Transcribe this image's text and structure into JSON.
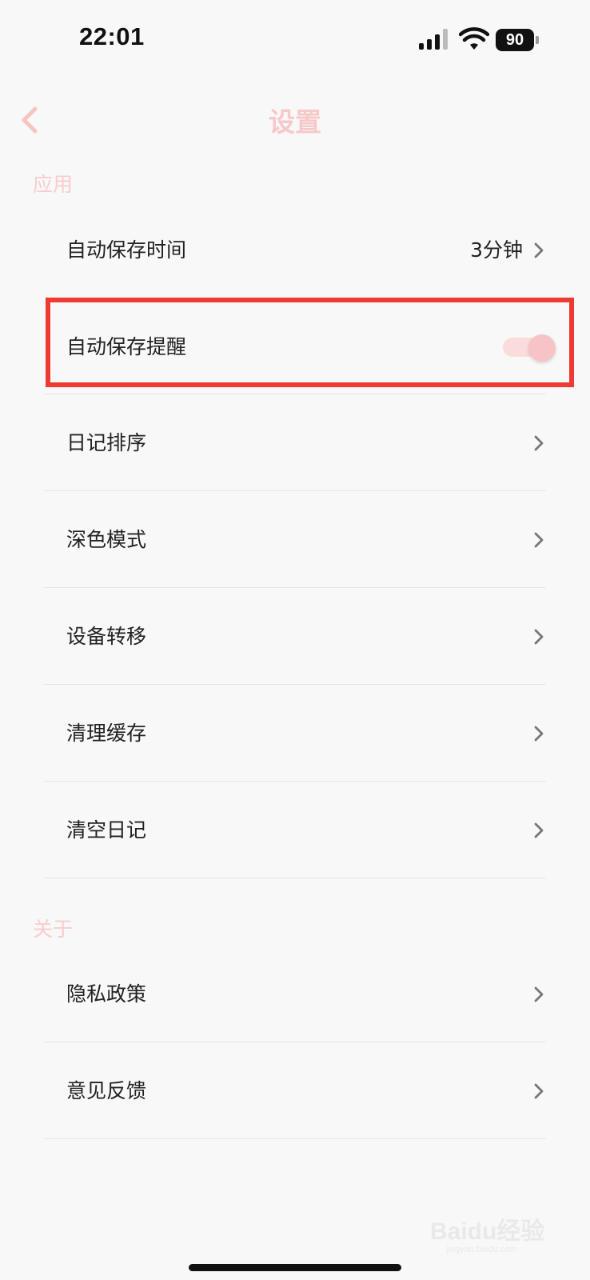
{
  "status_bar": {
    "time": "22:01",
    "battery": "90",
    "icons": [
      "signal-icon",
      "wifi-icon",
      "battery-icon"
    ]
  },
  "nav": {
    "title": "设置",
    "back_icon": "chevron-left-icon"
  },
  "sections": {
    "app": {
      "header": "应用",
      "rows": {
        "auto_save_time": {
          "label": "自动保存时间",
          "value": "3分钟"
        },
        "auto_save_reminder": {
          "label": "自动保存提醒",
          "toggle_on": true
        },
        "diary_sort": {
          "label": "日记排序"
        },
        "dark_mode": {
          "label": "深色模式"
        },
        "device_transfer": {
          "label": "设备转移"
        },
        "clear_cache": {
          "label": "清理缓存"
        },
        "clear_diary": {
          "label": "清空日记"
        }
      }
    },
    "about": {
      "header": "关于",
      "rows": {
        "privacy_policy": {
          "label": "隐私政策"
        },
        "feedback": {
          "label": "意见反馈"
        }
      }
    }
  },
  "watermark": {
    "main": "Baidu经验",
    "sub": "jingyan.baidu.com"
  },
  "colors": {
    "accent_pink": "#f7c8c8",
    "highlight_red": "#ef3a34",
    "background": "#f8f8f8"
  }
}
